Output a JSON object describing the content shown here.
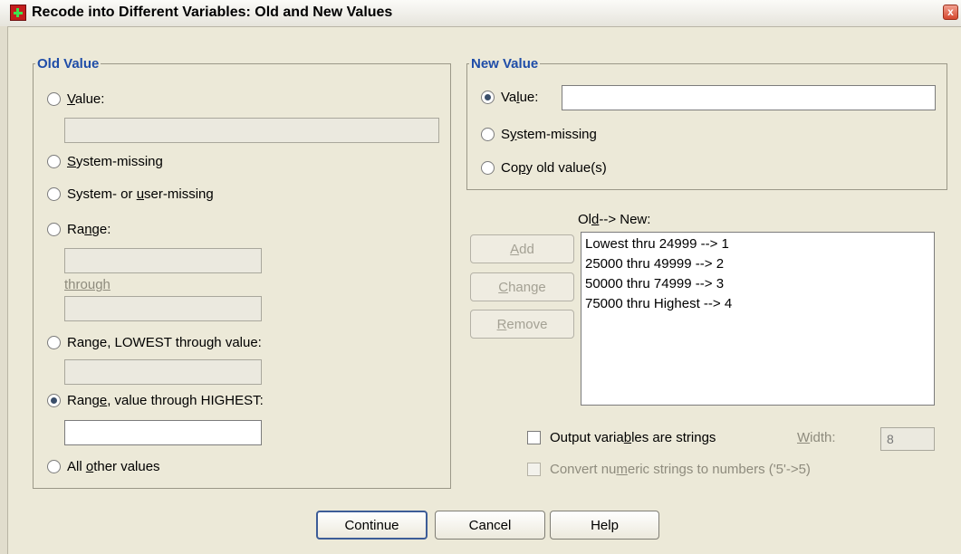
{
  "window": {
    "title": "Recode into Different Variables: Old and New Values",
    "close_glyph": "x"
  },
  "old_value": {
    "legend": "Old Value",
    "value": {
      "accel": "V",
      "rest": "alue:",
      "selected": false,
      "input": ""
    },
    "system_missing": {
      "accel": "S",
      "rest": "ystem-missing",
      "selected": false
    },
    "system_or_user_missing": {
      "pre": "System- or ",
      "accel": "u",
      "rest": "ser-missing",
      "selected": false
    },
    "range": {
      "pre": "Ra",
      "accel": "n",
      "rest": "ge:",
      "selected": false,
      "from": "",
      "through_label": "through",
      "to": ""
    },
    "range_lowest": {
      "label": "Range, LOWEST through value:",
      "selected": false,
      "input": ""
    },
    "range_highest": {
      "pre": "Rang",
      "accel": "e",
      "rest": ", value through HIGHEST:",
      "selected": true,
      "input": ""
    },
    "all_other": {
      "pre": "All ",
      "accel": "o",
      "rest": "ther values",
      "selected": false
    }
  },
  "new_value": {
    "legend": "New Value",
    "value": {
      "pre": "Va",
      "accel": "l",
      "rest": "ue:",
      "selected": true,
      "input": ""
    },
    "system_missing": {
      "pre": "S",
      "accel": "y",
      "rest": "stem-missing",
      "selected": false
    },
    "copy_old": {
      "pre": "Co",
      "accel": "p",
      "rest": "y old value(s)",
      "selected": false
    }
  },
  "mapping": {
    "label_pre": "Ol",
    "label_accel": "d",
    "label_rest": " --> New:",
    "items": [
      "Lowest thru 24999 --> 1",
      "25000 thru 49999 --> 2",
      "50000 thru 74999 --> 3",
      "75000 thru Highest --> 4"
    ],
    "add": {
      "accel": "A",
      "rest": "dd"
    },
    "change": {
      "accel": "C",
      "rest": "hange"
    },
    "remove": {
      "accel": "R",
      "rest": "emove"
    }
  },
  "options": {
    "output_strings": {
      "pre": "Output varia",
      "accel": "b",
      "rest": "les are strings",
      "checked": false
    },
    "width_label_accel": "W",
    "width_label_rest": "idth:",
    "width_value": "8",
    "convert_numeric": {
      "pre": "Convert nu",
      "accel": "m",
      "rest": "eric strings to numbers ('5'->5)",
      "checked": false
    }
  },
  "footer": {
    "continue": "Continue",
    "cancel": "Cancel",
    "help": "Help"
  },
  "colors": {
    "dialog_bg": "#ece9d8",
    "legend_blue": "#1f4da8",
    "title_icon_red": "#c41d1d"
  },
  "icons": {
    "title": "spss-recode-icon",
    "close": "close-icon"
  }
}
